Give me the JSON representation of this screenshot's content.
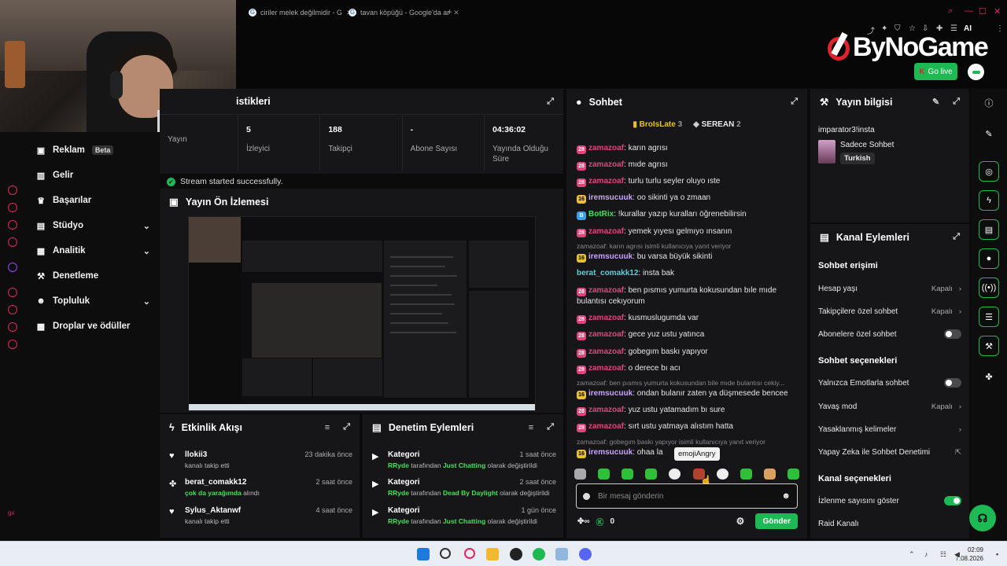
{
  "browser": {
    "tabs": [
      {
        "label": "ciriler melek değilmidir - G"
      },
      {
        "label": "tavan köpüğü - Google'da ar"
      }
    ],
    "new_tab": "+",
    "ai_label": "AI"
  },
  "brand": {
    "logo_text": "ByNoGame",
    "go_live": "Go live",
    "accent": "#1db954"
  },
  "sidebar": {
    "items": [
      {
        "label": "Reklam",
        "badge": "Beta",
        "icon": "megaphone-icon"
      },
      {
        "label": "Gelir",
        "icon": "chart-icon"
      },
      {
        "label": "Başarılar",
        "icon": "trophy-icon"
      },
      {
        "label": "Stüdyo",
        "icon": "film-icon",
        "chev": "⌄"
      },
      {
        "label": "Analitik",
        "icon": "graph-icon",
        "chev": "⌄"
      },
      {
        "label": "Denetleme",
        "icon": "hammer-icon"
      },
      {
        "label": "Topluluk",
        "icon": "users-icon",
        "chev": "⌄"
      },
      {
        "label": "Droplar ve ödüller",
        "icon": "gift-icon"
      }
    ]
  },
  "stats": {
    "title": "istikleri",
    "cells": [
      {
        "value": "",
        "label": "Yayın"
      },
      {
        "value": "5",
        "label": "İzleyici"
      },
      {
        "value": "188",
        "label": "Takipçi"
      },
      {
        "value": "-",
        "label": "Abone Sayısı"
      },
      {
        "value": "04:36:02",
        "label": "Yayında Olduğu Süre"
      }
    ]
  },
  "status_msg": "Stream started successfully.",
  "preview": {
    "title": "Yayın Ön İzlemesi"
  },
  "events": {
    "title": "Etkinlik Akışı",
    "items": [
      {
        "name": "llokii3",
        "desc": "kanalı takip etti",
        "time": "23 dakika önce",
        "icon": "heart-icon"
      },
      {
        "name": "berat_comakk12",
        "desc_green": "çok da yarağımda",
        "desc": " alındı",
        "time": "2 saat önce",
        "icon": "reward-icon"
      },
      {
        "name": "Sylus_Aktanwf",
        "desc": "kanalı takip etti",
        "time": "4 saat önce",
        "icon": "heart-icon"
      }
    ]
  },
  "moderation": {
    "title": "Denetim Eylemleri",
    "items": [
      {
        "name": "Kategori",
        "user": "RRyde",
        "mid": " tarafından ",
        "game": "Just Chatting",
        "end": " olarak değiştirildi",
        "time": "1 saat önce"
      },
      {
        "name": "Kategori",
        "user": "RRyde",
        "mid": " tarafından ",
        "game": "Dead By Daylight",
        "end": " olarak değiştirildi",
        "time": "2 saat önce"
      },
      {
        "name": "Kategori",
        "user": "RRyde",
        "mid": " tarafından ",
        "game": "Just Chatting",
        "end": " olarak değiştirildi",
        "time": "1 gün önce"
      }
    ]
  },
  "chat": {
    "title": "Sohbet",
    "pinned": [
      {
        "name": "BroIsLate",
        "count": "3"
      },
      {
        "name": "SEREAN",
        "count": "2"
      }
    ],
    "messages": [
      {
        "user": "zamazoaf",
        "color": "#e0457a",
        "badge": "28",
        "text": ": karın agrısı"
      },
      {
        "user": "zamazoaf",
        "color": "#e0457a",
        "badge": "28",
        "text": ": mıde agrısı"
      },
      {
        "user": "zamazoaf",
        "color": "#e0457a",
        "badge": "28",
        "text": ": turlu turlu seyler oluyo ıste"
      },
      {
        "user": "iremsucuuk",
        "color": "#c8a2ff",
        "badge": "16",
        "text": ": oo sikinti ya o zmaan"
      },
      {
        "user": "BotRix",
        "color": "#45e05a",
        "badge": "B",
        "text": ": !kurallar yazıp kuralları öğrenebilirsin"
      },
      {
        "user": "zamazoaf",
        "color": "#e0457a",
        "badge": "28",
        "text": ": yemek yıyesı gelmıyo ınsanın"
      },
      {
        "user": "iremsucuuk",
        "color": "#c8a2ff",
        "badge": "16",
        "text": ": bu varsa büyük sikinti"
      },
      {
        "user": "berat_comakk12",
        "color": "#4fd6d6",
        "badge": "",
        "text": ": insta bak"
      },
      {
        "user": "zamazoaf",
        "color": "#e0457a",
        "badge": "28",
        "text": ": ben pısmıs yumurta kokusundan bıle mıde bulantısı cekıyorum"
      },
      {
        "user": "zamazoaf",
        "color": "#e0457a",
        "badge": "28",
        "text": ": kusmuslugumda var"
      },
      {
        "user": "zamazoaf",
        "color": "#e0457a",
        "badge": "28",
        "text": ": gece yuz ustu yatınca"
      },
      {
        "user": "zamazoaf",
        "color": "#e0457a",
        "badge": "28",
        "text": ": gobegım baskı yapıyor"
      },
      {
        "user": "zamazoaf",
        "color": "#e0457a",
        "badge": "28",
        "text": ": o derece bı acı"
      },
      {
        "user": "iremsucuuk",
        "color": "#c8a2ff",
        "badge": "16",
        "text": ": ondan bulanır zaten ya düşmesede bencee"
      },
      {
        "user": "zamazoaf",
        "color": "#e0457a",
        "badge": "28",
        "text": ": yuz ustu yatamadım bı sure"
      },
      {
        "user": "zamazoaf",
        "color": "#e0457a",
        "badge": "28",
        "text": ": sırt ustu yatmaya alıstım hatta"
      },
      {
        "user": "iremsucuuk",
        "color": "#c8a2ff",
        "badge": "16",
        "text": ": ohaa la"
      }
    ],
    "replies": [
      "zamazoaf: karın agrısı isimli kullanıcıya yanıt veriyor",
      "zamazoaf: ben pısmıs yumurta kokusundan bile mıde bulantısı cekiy...",
      "zamazoaf: gobegım baskı yapıyor isimli kullanıcıya yanıt veriyor"
    ],
    "tooltip": "emojiAngry",
    "input_placeholder": "Bir mesaj gönderin",
    "points": "0",
    "send_label": "Gönder"
  },
  "stream_info": {
    "title": "Yayın bilgisi",
    "stream_title": "imparator3!insta",
    "category": "Sadece Sohbet",
    "tag": "Turkish"
  },
  "channel_actions": {
    "title": "Kanal Eylemleri",
    "section1": "Sohbet erişimi",
    "rows1": [
      {
        "label": "Hesap yaşı",
        "value": "Kapalı",
        "kind": "chev"
      },
      {
        "label": "Takipçilere özel sohbet",
        "value": "Kapalı",
        "kind": "chev"
      },
      {
        "label": "Abonelere özel sohbet",
        "value": "",
        "kind": "toggle",
        "on": false
      }
    ],
    "section2": "Sohbet seçenekleri",
    "rows2": [
      {
        "label": "Yalnızca Emotlarla sohbet",
        "value": "",
        "kind": "toggle",
        "on": false
      },
      {
        "label": "Yavaş mod",
        "value": "Kapalı",
        "kind": "chev"
      },
      {
        "label": "Yasaklanmış kelimeler",
        "value": "",
        "kind": "chev"
      },
      {
        "label": "Yapay Zeka ile Sohbet Denetimi",
        "value": "",
        "kind": "ext"
      }
    ],
    "section3": "Kanal seçenekleri",
    "rows3": [
      {
        "label": "İzlenme sayısını göster",
        "value": "",
        "kind": "toggle",
        "on": true
      },
      {
        "label": "Raid Kanalı",
        "value": "",
        "kind": "none"
      }
    ]
  },
  "taskbar": {
    "time": "02:09",
    "date": "7.08.2026"
  }
}
